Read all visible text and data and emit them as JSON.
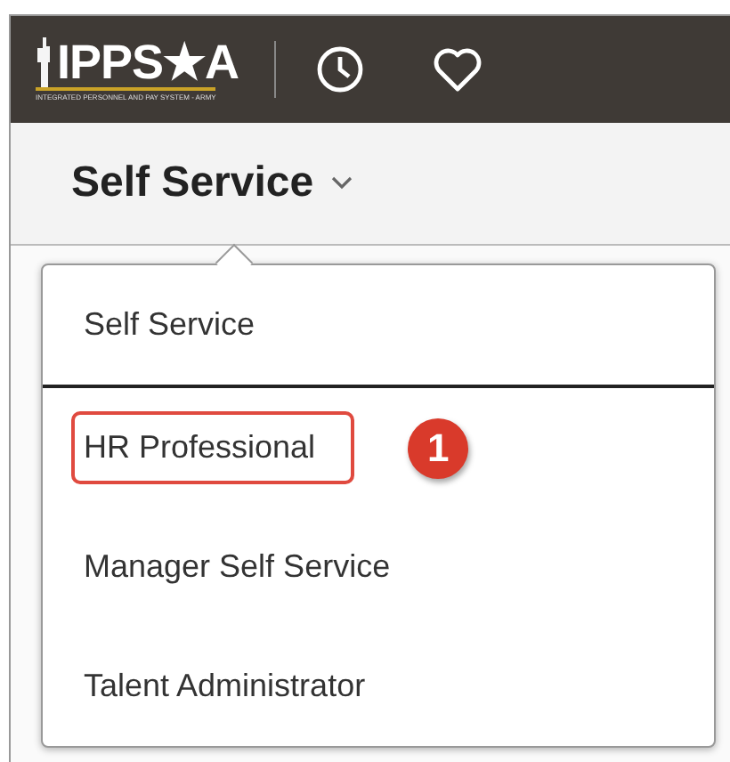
{
  "header": {
    "logo_text": "IPPS★A",
    "logo_subtitle": "INTEGRATED PERSONNEL AND PAY SYSTEM - ARMY"
  },
  "page_title": {
    "label": "Self Service"
  },
  "menu": {
    "items": [
      {
        "label": "Self Service",
        "selected": true,
        "highlighted": false
      },
      {
        "label": "HR Professional",
        "selected": false,
        "highlighted": true,
        "callout": "1"
      },
      {
        "label": "Manager Self Service",
        "selected": false,
        "highlighted": false
      },
      {
        "label": "Talent Administrator",
        "selected": false,
        "highlighted": false
      }
    ]
  }
}
